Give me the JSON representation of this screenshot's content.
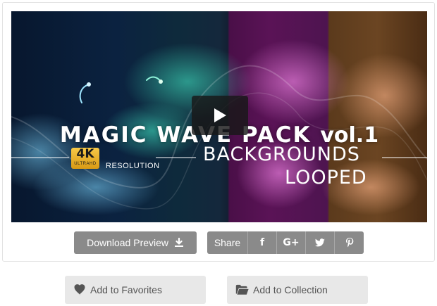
{
  "preview": {
    "title": "MAGIC WAVE PACK",
    "title_vol": "vol.1",
    "badge_big": "4K",
    "badge_small": "ULTRAHD",
    "resolution_label": "RESOLUTION",
    "subtitle_line1": "BACKGROUNDS",
    "subtitle_line2": "LOOPED",
    "play_icon": "play-icon"
  },
  "actions": {
    "download_label": "Download Preview",
    "download_icon": "download-icon",
    "share_label": "Share",
    "facebook_glyph": "f",
    "googleplus_glyph": "G+",
    "twitter_icon": "twitter-icon",
    "pinterest_glyph": "P"
  },
  "library": {
    "favorites_label": "Add to Favorites",
    "favorites_icon": "heart-icon",
    "collection_label": "Add to Collection",
    "collection_icon": "folder-icon"
  },
  "colors": {
    "button_gray": "#8a8a8a",
    "light_button": "#e8e8e8",
    "badge_gold": "#f7c948"
  }
}
